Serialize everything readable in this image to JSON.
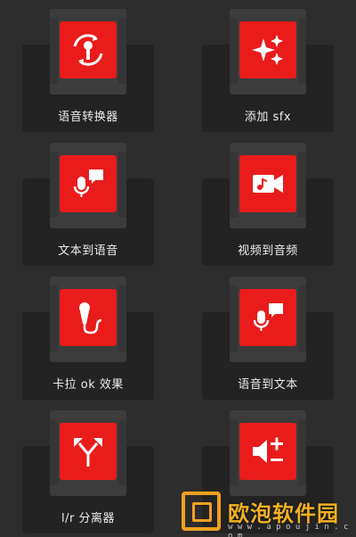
{
  "tiles": [
    {
      "label": "语音转换器",
      "icon": "mic-swap-icon"
    },
    {
      "label": "添加 sfx",
      "icon": "sparkles-icon"
    },
    {
      "label": "文本到语音",
      "icon": "mic-speech-bubble-icon"
    },
    {
      "label": "视频到音频",
      "icon": "video-music-icon"
    },
    {
      "label": "卡拉 ok 效果",
      "icon": "karaoke-mic-icon"
    },
    {
      "label": "语音到文本",
      "icon": "mic-speech-bubble-icon"
    },
    {
      "label": "l/r 分离器",
      "icon": "split-arrows-icon"
    },
    {
      "label": "",
      "icon": "volume-plus-minus-icon"
    }
  ],
  "watermark": {
    "text": "欧泡软件园",
    "url": "w w w . a p o u j i n . c o m"
  },
  "colors": {
    "background": "#2d2d2d",
    "accent": "#ea1b1b",
    "watermark": "#f0a020"
  }
}
